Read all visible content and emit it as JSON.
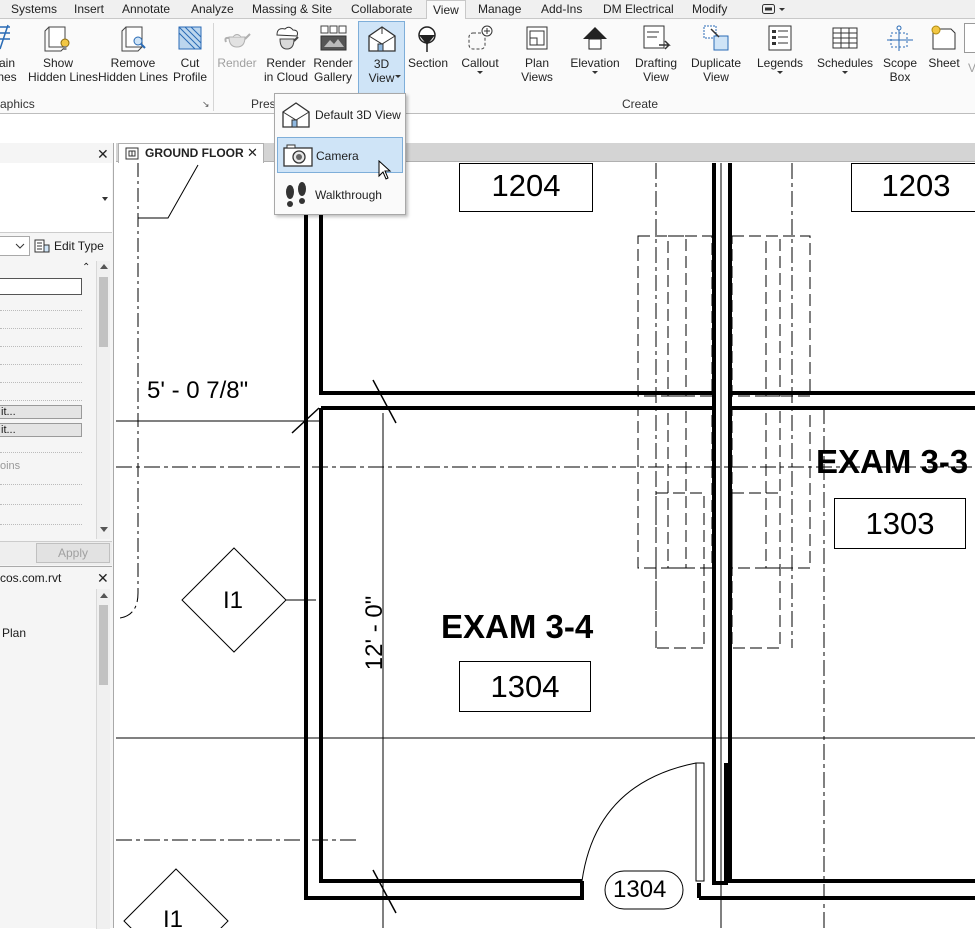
{
  "menu": {
    "tabs": [
      "Systems",
      "Insert",
      "Annotate",
      "Analyze",
      "Massing & Site",
      "Collaborate",
      "View",
      "Manage",
      "Add-Ins",
      "DM Electrical",
      "Modify"
    ],
    "active_tab": "View"
  },
  "ribbon": {
    "buttons": {
      "thin_lines": "ain\nnes",
      "show_hidden_lines": "Show\nHidden Lines",
      "remove_hidden_lines": "Remove\nHidden Lines",
      "cut_profile": "Cut\nProfile",
      "render": "Render",
      "render_in_cloud": "Render\nin Cloud",
      "render_gallery": "Render\nGallery",
      "view_3d": "3D\nView",
      "section": "Section",
      "callout": "Callout",
      "plan_views": "Plan\nViews",
      "elevation": "Elevation",
      "drafting_view": "Drafting\nView",
      "duplicate_view": "Duplicate\nView",
      "legends": "Legends",
      "schedules": "Schedules",
      "scope_box": "Scope\nBox",
      "sheet": "Sheet"
    },
    "panels": {
      "graphics": "aphics",
      "presentation": "Pres",
      "create": "Create"
    }
  },
  "dropdown": {
    "items": [
      "Default 3D View",
      "Camera",
      "Walkthrough"
    ],
    "hovered": "Camera"
  },
  "properties": {
    "edit_type": "Edit Type",
    "edit_btn_1": "it...",
    "edit_btn_2": "it...",
    "faded_row": "oins",
    "apply": "Apply"
  },
  "project_browser": {
    "title": "cos.com.rvt",
    "item": "Plan"
  },
  "view_tab": {
    "title": "GROUND FLOOR"
  },
  "drawing": {
    "rooms": [
      {
        "name": "",
        "number": "1204"
      },
      {
        "name": "",
        "number": "1203"
      },
      {
        "name": "EXAM 3-3",
        "number": "1303"
      },
      {
        "name": "EXAM 3-4",
        "number": "1304"
      }
    ],
    "dimension_horizontal": "5' - 0 7/8\"",
    "dimension_vertical": "12' - 0\"",
    "door_tag": "1304",
    "elevation_tag_1": "I1",
    "elevation_tag_2": "I1"
  },
  "colors": {
    "ribbon_bg": "#fafafa",
    "highlight": "#cfe4f7",
    "highlight_border": "#7eaed9",
    "drawing_line": "#000000"
  }
}
